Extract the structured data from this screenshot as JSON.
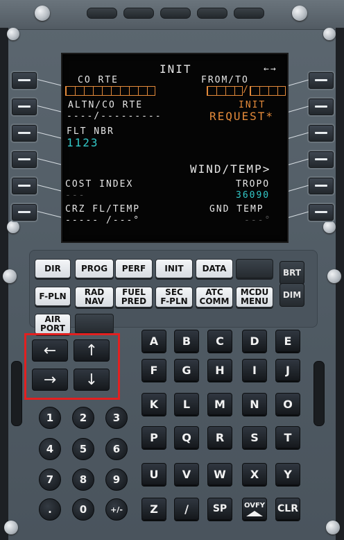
{
  "screen": {
    "title": "INIT",
    "arrows": "←→",
    "l1_label": "CO RTE",
    "r1_label": "FROM/TO",
    "l2_label": "ALTN/CO RTE",
    "l2_value": "----/---------",
    "r2_label": "INIT",
    "r2_value": "REQUEST*",
    "l3_label": "FLT NBR",
    "l3_value": "1123",
    "r4_value": "WIND/TEMP>",
    "l5_label": "COST INDEX",
    "l5_value": "---",
    "r5_label": "TROPO",
    "r5_value": "36090",
    "l6_label": "CRZ FL/TEMP",
    "l6_value": "----- /---°",
    "r6_label": "GND TEMP",
    "r6_value": "---°"
  },
  "function_keys": {
    "dir": "DIR",
    "prog": "PROG",
    "perf": "PERF",
    "init": "INIT",
    "data": "DATA",
    "fpln": "F-PLN",
    "radnav_1": "RAD",
    "radnav_2": "NAV",
    "fuel_1": "FUEL",
    "fuel_2": "PRED",
    "sec_1": "SEC",
    "sec_2": "F-PLN",
    "atc_1": "ATC",
    "atc_2": "COMM",
    "mcdu_1": "MCDU",
    "mcdu_2": "MENU",
    "air_1": "AIR",
    "air_2": "PORT",
    "brt": "BRT",
    "dim": "DIM"
  },
  "alpha_keys": [
    "A",
    "B",
    "C",
    "D",
    "E",
    "F",
    "G",
    "H",
    "I",
    "J",
    "K",
    "L",
    "M",
    "N",
    "O",
    "P",
    "Q",
    "R",
    "S",
    "T",
    "U",
    "V",
    "W",
    "X",
    "Y",
    "Z",
    "/",
    "SP",
    "OVFY",
    "CLR"
  ],
  "numeric_keys": [
    "1",
    "2",
    "3",
    "4",
    "5",
    "6",
    "7",
    "8",
    "9",
    ".",
    "0",
    "+/-"
  ],
  "arrow_keys": {
    "left": "←",
    "up": "↑",
    "right": "→",
    "down": "↓"
  },
  "colors": {
    "amber": "#e48a3a",
    "cyan": "#33c9c9",
    "white": "#e6e6e6",
    "highlight": "#e32020"
  }
}
